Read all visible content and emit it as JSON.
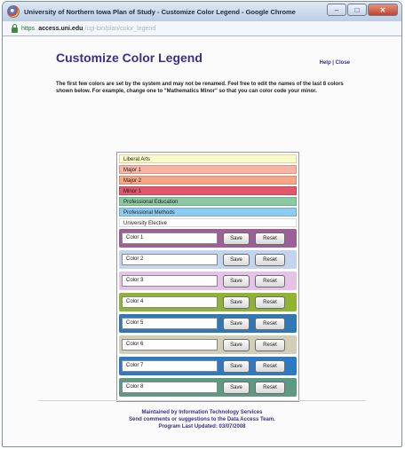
{
  "window": {
    "title": "University of Northern Iowa Plan of Study - Customize Color Legend - Google Chrome",
    "controls": {
      "minimize": "–",
      "maximize": "□",
      "close": "✕"
    }
  },
  "address": {
    "scheme": "https",
    "host": "access.uni.edu",
    "path": "/cgi-bin/plan/color_legend"
  },
  "page": {
    "title": "Customize Color Legend",
    "help": "Help",
    "separator": "|",
    "close": "Close",
    "intro": "The first few colors are set by the system and may not be renamed. Feel free to edit the names of the last 8 colors shown below. For example, change one to \"Mathematics Minor\" so that you can color code your minor."
  },
  "legend": {
    "fixed": [
      {
        "label": "Liberal Arts",
        "color": "#fdfbc9"
      },
      {
        "label": "Major 1",
        "color": "#f7b4a4"
      },
      {
        "label": "Major 2",
        "color": "#f4a686"
      },
      {
        "label": "Minor 1",
        "color": "#e0566a"
      },
      {
        "label": "Professional Education",
        "color": "#8bc9a2"
      },
      {
        "label": "Professional Methods",
        "color": "#8ecbf0"
      },
      {
        "label": "University Elective",
        "color": "#ffffff"
      }
    ],
    "custom": [
      {
        "value": "Color 1",
        "color": "#9c5f98"
      },
      {
        "value": "Color 2",
        "color": "#c3d4ee"
      },
      {
        "value": "Color 3",
        "color": "#e5c3e8"
      },
      {
        "value": "Color 4",
        "color": "#8fb432"
      },
      {
        "value": "Color 5",
        "color": "#2f77b5"
      },
      {
        "value": "Color 6",
        "color": "#d2cfb8"
      },
      {
        "value": "Color 7",
        "color": "#2e79c4"
      },
      {
        "value": "Color 8",
        "color": "#5e9a83"
      }
    ],
    "save_label": "Save",
    "reset_label": "Reset"
  },
  "footer": {
    "line1": "Maintained by Information Technology Services",
    "line2": "Send comments or suggestions to the Data Access Team.",
    "line3": "Program Last Updated: 03/07/2008"
  }
}
